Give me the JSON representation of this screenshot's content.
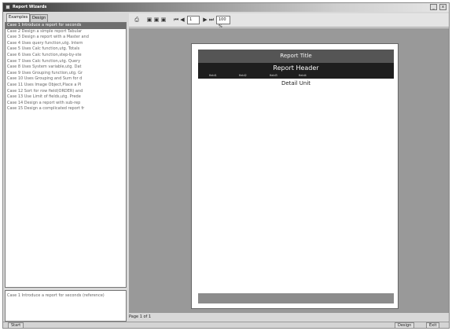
{
  "window": {
    "title": "Report Wizards",
    "minimize_label": "_",
    "close_label": "x"
  },
  "tabs": [
    {
      "label": "Examples"
    },
    {
      "label": "Design"
    }
  ],
  "cases": [
    "Case 1 Introduce a report for seconds",
    "Case 2 Design a simple report Tabular",
    "Case 3 Design a report with a Master and",
    "Case 4 Uses query function,utg. Intern",
    "Case 5 Uses Calc function,utg. Totals",
    "Case 6 Uses Calc function,step-by-ste",
    "Case 7 Uses Calc function,utg. Query",
    "Case 8 Uses System variable,utg. Dat",
    "Case 9 Uses Grouping function,utg. Gr",
    "Case 10 Uses Grouping and Sum for d",
    "Case 11 Uses Image Object,Place a Pi",
    "Case 12 Sort for row field(ORDER) and",
    "Case 13 Use Limit of fields,utg. Prede",
    "Case 14 Design a report with sub-rep",
    "Case 15 Design a complicated report fr"
  ],
  "selected_case_index": 0,
  "description_text": "Case 1 Introduce a report for seconds (reference)",
  "toolbar": {
    "print_icon": "printer-icon",
    "page_field_value": "1",
    "zoom_value": "100 %"
  },
  "report": {
    "title": "Report Title",
    "header": "Report Header",
    "columns": [
      "field1",
      "field2",
      "field3",
      "field4"
    ],
    "detail": "Detail Unit"
  },
  "page_indicator": "Page 1 of 1",
  "statusbar": {
    "left_button": "Start",
    "design_button": "Design",
    "exit_button": "Exit"
  }
}
